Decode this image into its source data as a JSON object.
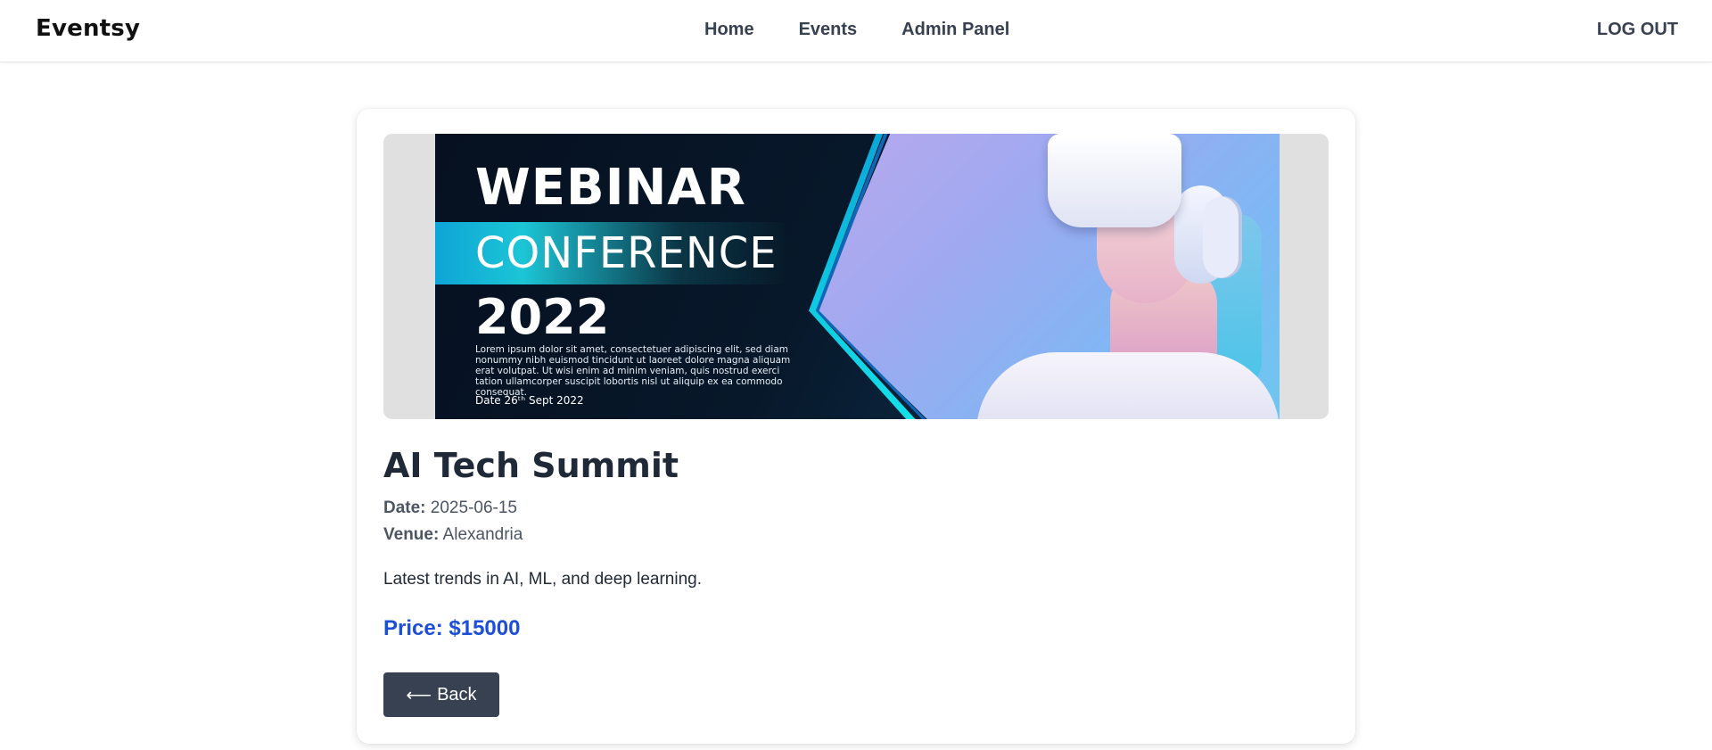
{
  "navbar": {
    "brand": "Eventsy",
    "links": [
      "Home",
      "Events",
      "Admin Panel"
    ],
    "logout": "LOG OUT"
  },
  "banner": {
    "title": "WEBINAR",
    "subtitle": "CONFERENCE",
    "year": "2022",
    "body": "Lorem ipsum dolor sit amet, consectetuer adipiscing elit, sed diam nonummy nibh euismod tincidunt ut laoreet dolore magna aliquam erat volutpat. Ut wisi enim ad minim veniam, quis nostrud exerci tation ullamcorper suscipit lobortis nisl ut aliquip ex ea commodo consequat.",
    "date": "Date 26ᵗʰ Sept 2022"
  },
  "event": {
    "title": "AI Tech Summit",
    "date_label": "Date:",
    "date": "2025-06-15",
    "venue_label": "Venue:",
    "venue": "Alexandria",
    "description": "Latest trends in AI, ML, and deep learning.",
    "price": "Price: $15000"
  },
  "actions": {
    "back_icon": "⟵",
    "back_label": "Back"
  },
  "colors": {
    "price": "#1d4ed8",
    "button_bg": "#374151",
    "banner_bg": "#061020",
    "accent_cyan": "#14e0e8"
  }
}
